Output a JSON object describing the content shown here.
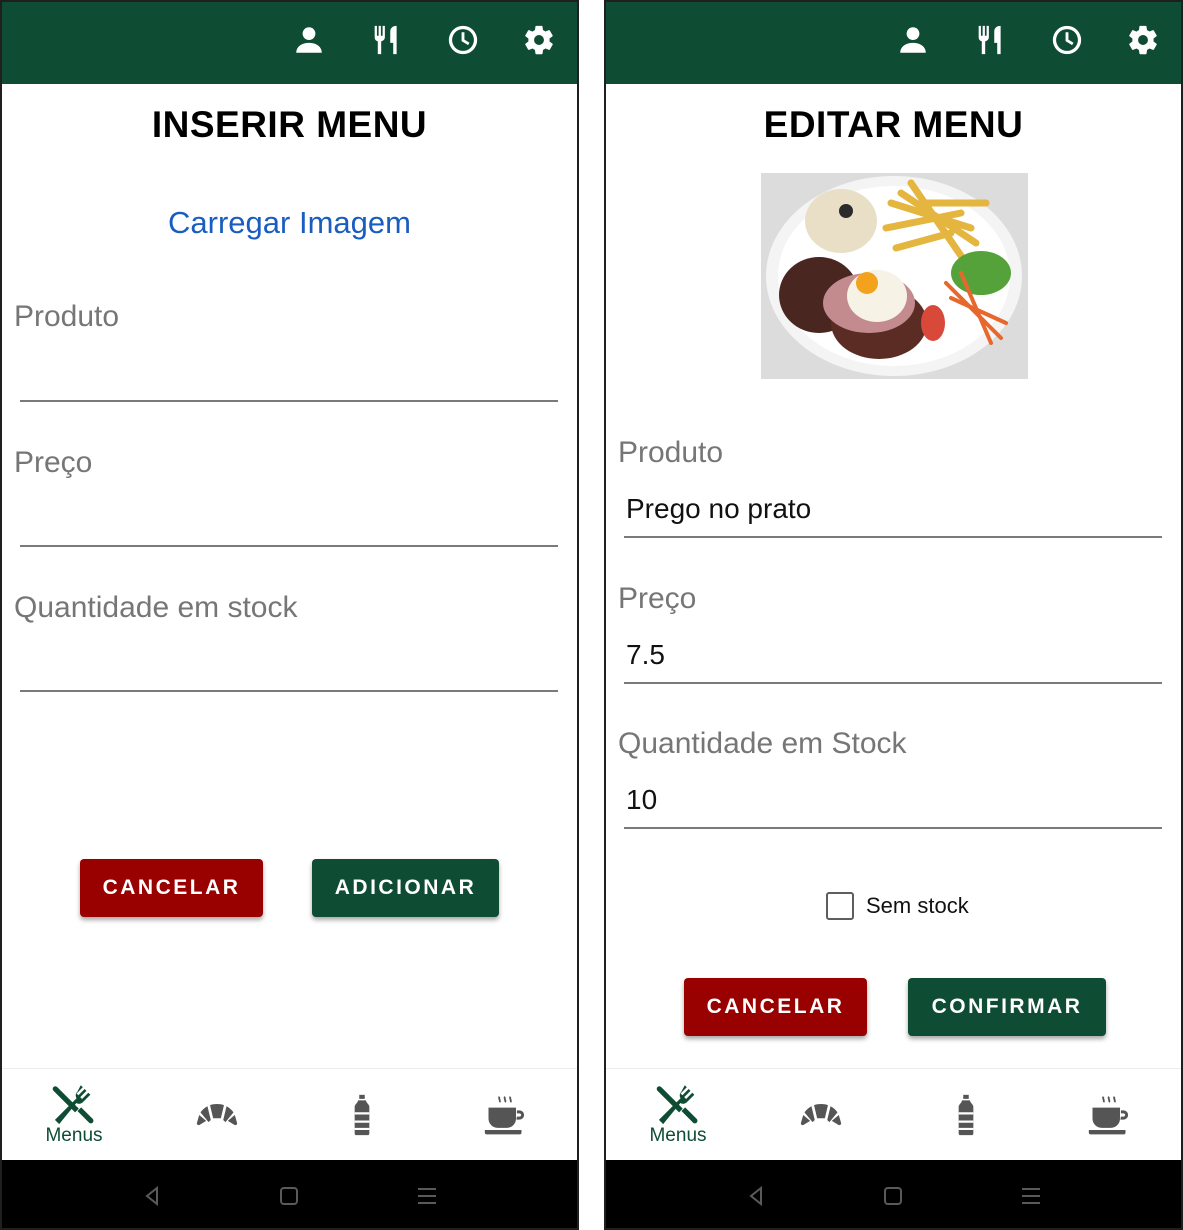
{
  "screens": [
    {
      "title": "INSERIR MENU",
      "upload_link": "Carregar Imagem",
      "fields": [
        {
          "label": "Produto",
          "value": ""
        },
        {
          "label": "Preço",
          "value": ""
        },
        {
          "label": "Quantidade em stock",
          "value": ""
        }
      ],
      "cancel_label": "CANCELAR",
      "primary_label": "ADICIONAR",
      "nav_active_label": "Menus"
    },
    {
      "title": "EDITAR MENU",
      "fields": [
        {
          "label": "Produto",
          "value": "Prego no prato"
        },
        {
          "label": "Preço",
          "value": "7.5"
        },
        {
          "label": "Quantidade em Stock",
          "value": "10"
        }
      ],
      "checkbox": {
        "label": "Sem stock",
        "checked": false
      },
      "cancel_label": "CANCELAR",
      "primary_label": "CONFIRMAR",
      "nav_active_label": "Menus"
    }
  ],
  "icons": {
    "top_bar": [
      "person-icon",
      "utensils-icon",
      "clock-icon",
      "gear-icon"
    ],
    "bottom_nav": [
      "menus-icon",
      "croissant-icon",
      "bottle-icon",
      "coffee-icon"
    ],
    "system_nav": [
      "back-icon",
      "home-icon",
      "recents-icon"
    ]
  },
  "colors": {
    "header_green": "#0e4c33",
    "button_red": "#990000",
    "button_green": "#0e4c33",
    "link_blue": "#1a5dc0",
    "inactive_icon_gray": "#555555"
  }
}
